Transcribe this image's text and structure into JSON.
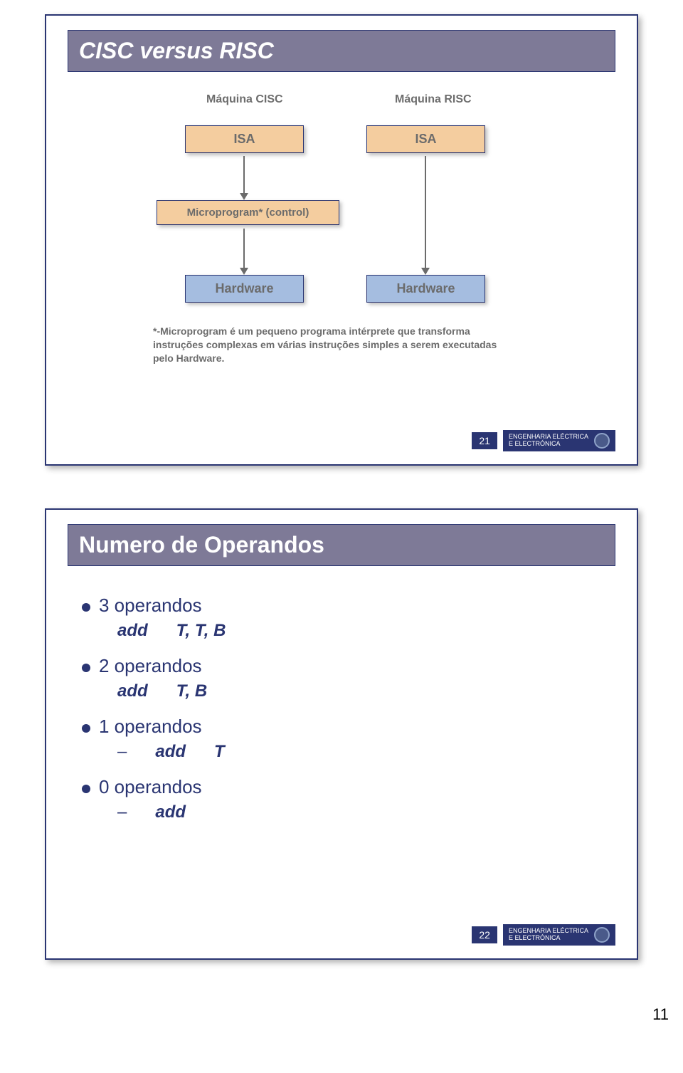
{
  "slide1": {
    "title": "CISC versus RISC",
    "cisc_label": "Máquina CISC",
    "risc_label": "Máquina RISC",
    "isa_left": "ISA",
    "isa_right": "ISA",
    "microprogram": "Microprogram* (control)",
    "hardware_left": "Hardware",
    "hardware_right": "Hardware",
    "footnote": "*-Microprogram é um pequeno programa intérprete que transforma instruções complexas em várias instruções simples a serem executadas pelo Hardware.",
    "slidenum": "21",
    "footer_line1": "ENGENHARIA ELÉCTRICA",
    "footer_line2": "E ELECTRÓNICA"
  },
  "slide2": {
    "title": "Numero de Operandos",
    "items": [
      {
        "label": "3 operandos",
        "sub_cmd": "add",
        "sub_arg": "T, T, B",
        "dash": false
      },
      {
        "label": "2 operandos",
        "sub_cmd": "add",
        "sub_arg": "T, B",
        "dash": false
      },
      {
        "label": "1 operandos",
        "sub_cmd": "add",
        "sub_arg": "T",
        "dash": true
      },
      {
        "label": "0 operandos",
        "sub_cmd": "add",
        "sub_arg": "",
        "dash": true
      }
    ],
    "slidenum": "22",
    "footer_line1": "ENGENHARIA ELÉCTRICA",
    "footer_line2": "E ELECTRÓNICA"
  },
  "pagenum": "11"
}
